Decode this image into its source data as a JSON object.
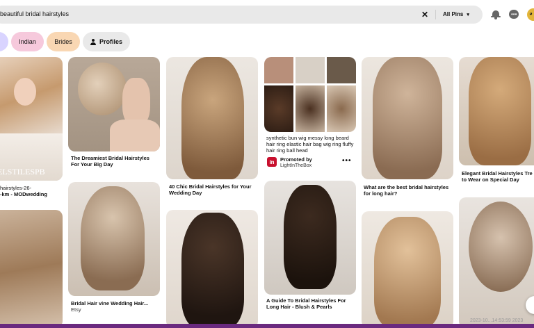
{
  "search": {
    "query": "beautiful bridal hairstyles",
    "filter": "All Pins"
  },
  "chips": {
    "indian": "Indian",
    "brides": "Brides",
    "profiles": "Profiles"
  },
  "pins": {
    "p1_cap": "hairstyles-26-",
    "p1_cap2": "-km - MODwedding",
    "p1_wm": "ELSTILESPB",
    "p2_cap": "The Dreamiest Bridal Hairstyles For Your Big Day",
    "p3_cap": "40 Chic Bridal Hairstyles for Your Wedding Day",
    "p4_cap": "synthetic bun wig messy long beard hair ring elastic hair bag wig ring fluffy hair ring ball head",
    "p4_promo": "Promoted by",
    "p4_brand": "LightInTheBox",
    "p5_cap": "What are the best bridal hairstyles for long hair?",
    "p6_cap": "Elegant Bridal Hairstyles Tre to Wear on Special Day",
    "p7_cap": "Bridal Hair vine Wedding Hair...",
    "p7_sub": "Etsy",
    "p8_cap": "A Guide To Bridal Hairstyles For Long Hair - Blush & Pearls"
  },
  "overlay": {
    "timestamp": "2023-10...14:53:59 2023"
  },
  "colors": {
    "searchBg": "#e9e9e9",
    "chipIndian": "#f6c9dc",
    "chipBrides": "#f9d7b3",
    "chipProfiles": "#e9e9e9"
  }
}
